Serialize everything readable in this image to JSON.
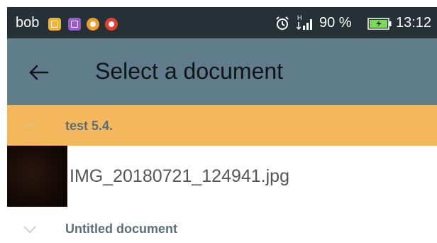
{
  "status_bar": {
    "carrier": "bob",
    "battery_percent": "90 %",
    "time": "13:12",
    "icons": [
      "notification-app-icon-1",
      "notification-app-icon-2",
      "notification-app-icon-3",
      "notification-app-icon-4",
      "alarm-icon",
      "signal-icon",
      "battery-icon"
    ]
  },
  "app_bar": {
    "back_icon": "arrow-left-icon",
    "title": "Select a document"
  },
  "folders": [
    {
      "name": "test 5.4.",
      "expanded": true,
      "chevron_icon": "chevron-up-icon",
      "documents": [
        {
          "name": "IMG_20180721_124941.jpg",
          "thumbnail": "dark-photo-thumbnail"
        }
      ]
    },
    {
      "name": "Untitled document",
      "expanded": false,
      "chevron_icon": "chevron-down-icon",
      "documents": []
    }
  ],
  "colors": {
    "status_bar_bg": "#263037",
    "app_bar_bg": "#607d8b",
    "folder_highlight_bg": "#f4b75c",
    "folder_text": "#5b6f79",
    "doc_text": "#555555"
  }
}
